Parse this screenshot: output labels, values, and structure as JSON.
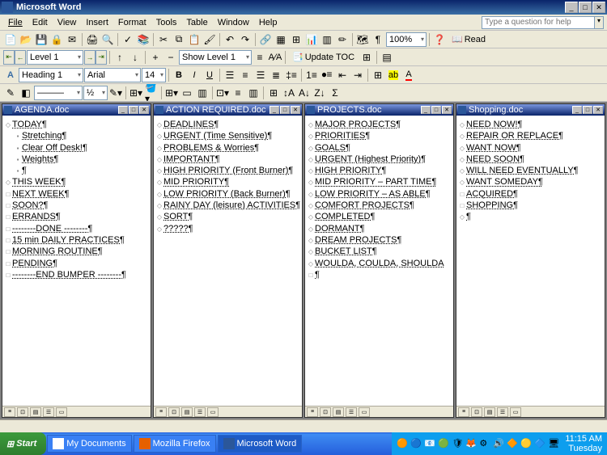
{
  "app": {
    "title": "Microsoft Word"
  },
  "menu": [
    "File",
    "Edit",
    "View",
    "Insert",
    "Format",
    "Tools",
    "Table",
    "Window",
    "Help"
  ],
  "help_placeholder": "Type a question for help",
  "outline": {
    "level_label": "Level 1",
    "show_level": "Show Level 1",
    "update_toc": "Update TOC"
  },
  "formatting": {
    "style": "Heading 1",
    "font": "Arial",
    "size": "14",
    "zoom": "100%",
    "read_label": "Read"
  },
  "docs": [
    {
      "title": "AGENDA.doc",
      "lines": [
        {
          "marker": "◇",
          "indent": 0,
          "text": "TODAY¶"
        },
        {
          "marker": "▪",
          "indent": 1,
          "text": "Stretching¶"
        },
        {
          "marker": "▪",
          "indent": 1,
          "text": "Clear Off Desk!¶"
        },
        {
          "marker": "▪",
          "indent": 1,
          "text": "Weights¶"
        },
        {
          "marker": "▪",
          "indent": 1,
          "text": "¶"
        },
        {
          "marker": "◇",
          "indent": 0,
          "text": "THIS WEEK¶"
        },
        {
          "marker": "□",
          "indent": 0,
          "text": "NEXT WEEK¶"
        },
        {
          "marker": "□",
          "indent": 0,
          "text": "SOON?¶"
        },
        {
          "marker": "□",
          "indent": 0,
          "text": "ERRANDS¶"
        },
        {
          "marker": "□",
          "indent": 0,
          "text": "--------DONE --------¶"
        },
        {
          "marker": "□",
          "indent": 0,
          "text": "15 min DAILY PRACTICES¶"
        },
        {
          "marker": "□",
          "indent": 0,
          "text": "MORNING ROUTINE¶"
        },
        {
          "marker": "□",
          "indent": 0,
          "text": "PENDING¶"
        },
        {
          "marker": "□",
          "indent": 0,
          "text": "--------END BUMPER --------¶"
        }
      ]
    },
    {
      "title": "ACTION REQUIRED.doc",
      "lines": [
        {
          "marker": "◇",
          "indent": 0,
          "text": "DEADLINES¶"
        },
        {
          "marker": "◇",
          "indent": 0,
          "text": "URGENT (Time Sensitive)¶"
        },
        {
          "marker": "◇",
          "indent": 0,
          "text": "PROBLEMS & Worries¶"
        },
        {
          "marker": "◇",
          "indent": 0,
          "text": "IMPORTANT¶"
        },
        {
          "marker": "◇",
          "indent": 0,
          "text": "HIGH PRIORITY (Front Burner)¶"
        },
        {
          "marker": "◇",
          "indent": 0,
          "text": "MID PRIORITY¶"
        },
        {
          "marker": "◇",
          "indent": 0,
          "text": "LOW PRIORITY (Back Burner)¶"
        },
        {
          "marker": "◇",
          "indent": 0,
          "text": "RAINY DAY (leisure) ACTIVITIES¶"
        },
        {
          "marker": "◇",
          "indent": 0,
          "text": "SORT¶"
        },
        {
          "marker": "◇",
          "indent": 0,
          "text": "?????¶"
        }
      ]
    },
    {
      "title": "PROJECTS.doc",
      "lines": [
        {
          "marker": "◇",
          "indent": 0,
          "text": "MAJOR PROJECTS¶"
        },
        {
          "marker": "◇",
          "indent": 0,
          "text": "PRIORITIES¶"
        },
        {
          "marker": "◇",
          "indent": 0,
          "text": "GOALS¶"
        },
        {
          "marker": "◇",
          "indent": 0,
          "text": "URGENT (Highest Priority)¶"
        },
        {
          "marker": "◇",
          "indent": 0,
          "text": "HIGH PRIORITY¶"
        },
        {
          "marker": "◇",
          "indent": 0,
          "text": "MID PRIORITY – PART TIME¶"
        },
        {
          "marker": "◇",
          "indent": 0,
          "text": "LOW PRIORITY – AS ABLE¶"
        },
        {
          "marker": "◇",
          "indent": 0,
          "text": "COMFORT PROJECTS¶"
        },
        {
          "marker": "◇",
          "indent": 0,
          "text": "COMPLETED¶"
        },
        {
          "marker": "◇",
          "indent": 0,
          "text": "DORMANT¶"
        },
        {
          "marker": "◇",
          "indent": 0,
          "text": "DREAM PROJECTS¶"
        },
        {
          "marker": "◇",
          "indent": 0,
          "text": "BUCKET LIST¶"
        },
        {
          "marker": "◇",
          "indent": 0,
          "text": "WOULDA, COULDA, SHOULDA"
        },
        {
          "marker": "□",
          "indent": 0,
          "text": "¶"
        }
      ]
    },
    {
      "title": "Shopping.doc",
      "lines": [
        {
          "marker": "◇",
          "indent": 0,
          "text": "NEED NOW!¶"
        },
        {
          "marker": "◇",
          "indent": 0,
          "text": "REPAIR OR REPLACE¶"
        },
        {
          "marker": "◇",
          "indent": 0,
          "text": "WANT NOW¶"
        },
        {
          "marker": "◇",
          "indent": 0,
          "text": "NEED SOON¶"
        },
        {
          "marker": "◇",
          "indent": 0,
          "text": "WILL NEED EVENTUALLY¶"
        },
        {
          "marker": "◇",
          "indent": 0,
          "text": "WANT SOMEDAY¶"
        },
        {
          "marker": "□",
          "indent": 0,
          "text": "ACQUIRED¶"
        },
        {
          "marker": "□",
          "indent": 0,
          "text": "SHOPPING¶"
        },
        {
          "marker": "◇",
          "indent": 0,
          "text": "¶"
        }
      ]
    }
  ],
  "taskbar": {
    "start": "Start",
    "buttons": [
      "My Documents",
      "Mozilla Firefox",
      "Microsoft Word"
    ]
  },
  "clock": {
    "time": "11:15 AM",
    "day": "Tuesday"
  }
}
